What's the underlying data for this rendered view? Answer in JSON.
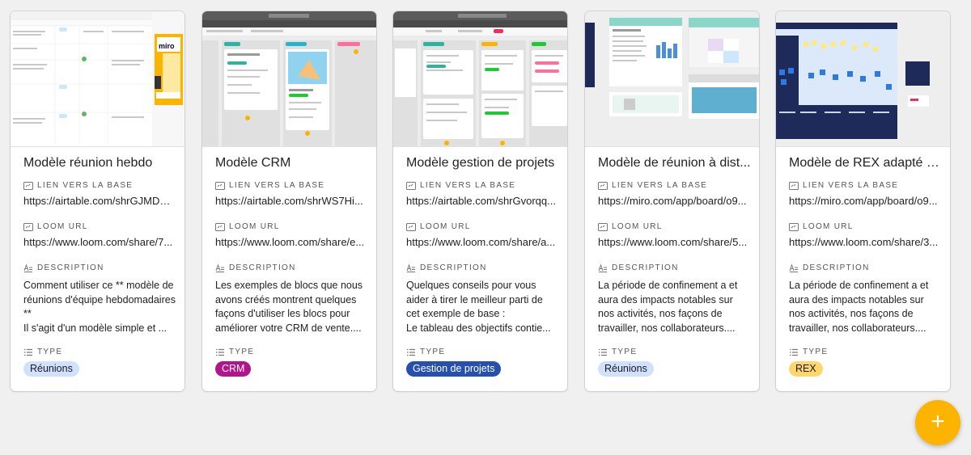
{
  "field_labels": {
    "base": "LIEN VERS LA BASE",
    "loom": "LOOM URL",
    "description": "DESCRIPTION",
    "type": "TYPE"
  },
  "field_icons": {
    "base": "url-field-icon",
    "loom": "url-field-icon",
    "description": "long-text-field-icon",
    "type": "multi-select-field-icon"
  },
  "cards": [
    {
      "title": "Modèle réunion hebdo",
      "base_url": "https://airtable.com/shrGJMDN...",
      "loom_url": "https://www.loom.com/share/7...",
      "description": "Comment utiliser ce ** modèle de réunions d'équipe hebdomadaires **\nIl s'agit d'un modèle simple et ...",
      "type": "Réunions",
      "type_bg": "#d0e1fd",
      "type_fg": "#1a1a1a",
      "thumbnail": "airtable-grid-with-miro-screenshot"
    },
    {
      "title": "Modèle CRM",
      "base_url": "https://airtable.com/shrWS7Hi...",
      "loom_url": "https://www.loom.com/share/e...",
      "description": "Les exemples de blocs que nous avons créés montrent quelques façons d'utiliser les blocs pour améliorer votre CRM de vente....",
      "type": "CRM",
      "type_bg": "#b2158b",
      "type_fg": "#ffffff",
      "thumbnail": "airtable-kanban-crm-screenshot"
    },
    {
      "title": "Modèle gestion de projets",
      "base_url": "https://airtable.com/shrGvorqq...",
      "loom_url": "https://www.loom.com/share/a...",
      "description": "Quelques conseils pour vous aider à tirer le meilleur parti de cet exemple de base :\nLe tableau des objectifs contie...",
      "type": "Gestion de projets",
      "type_bg": "#2750ae",
      "type_fg": "#ffffff",
      "thumbnail": "airtable-kanban-projects-screenshot"
    },
    {
      "title": "Modèle de réunion à dist...",
      "base_url": "https://miro.com/app/board/o9...",
      "loom_url": "https://www.loom.com/share/5...",
      "description": "La période de confinement a et aura des impacts notables sur nos activités, nos façons de travailler, nos collaborateurs....",
      "type": "Réunions",
      "type_bg": "#d0e1fd",
      "type_fg": "#1a1a1a",
      "thumbnail": "miro-board-remote-meeting-screenshot"
    },
    {
      "title": "Modèle de REX adapté a...",
      "base_url": "https://miro.com/app/board/o9...",
      "loom_url": "https://www.loom.com/share/3...",
      "description": "La période de confinement a et aura des impacts notables sur nos activités, nos façons de travailler, nos collaborateurs....",
      "type": "REX",
      "type_bg": "#ffd66e",
      "type_fg": "#1a1a1a",
      "thumbnail": "miro-board-rex-screenshot"
    }
  ],
  "fab": {
    "label": "+",
    "icon": "plus-icon",
    "color": "#fcb400"
  }
}
